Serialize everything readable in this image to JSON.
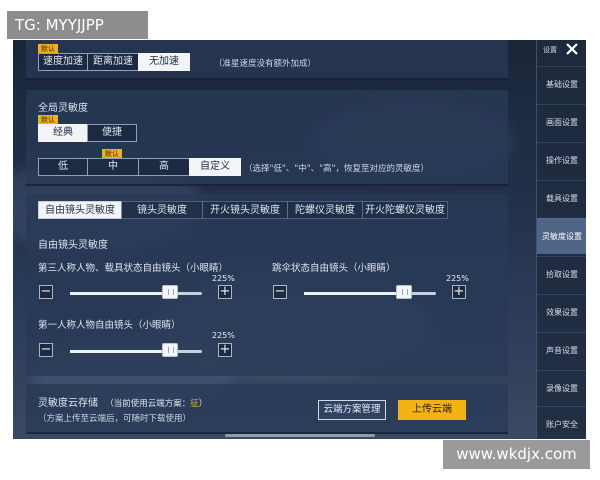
{
  "watermarks": {
    "top_left": "TG: MYYJJPP",
    "bottom_right": "www.wkdjx.com"
  },
  "speed_panel": {
    "default_badge": "默认",
    "options": [
      "速度加速",
      "距离加速",
      "无加速"
    ],
    "selected": "无加速",
    "note": "（准星速度没有额外加成）"
  },
  "global_sensitivity": {
    "title": "全局灵敏度",
    "mode_badge": "默认",
    "mode_options": [
      "经典",
      "便捷"
    ],
    "mode_selected": "经典",
    "level_badge": "默认",
    "level_options": [
      "低",
      "中",
      "高",
      "自定义"
    ],
    "level_selected": "自定义",
    "level_note": "（选择\"低\"、\"中\"、\"高\"，恢复至对应的灵敏度）"
  },
  "sensitivity_tabs": {
    "items": [
      "自由镜头灵敏度",
      "镜头灵敏度",
      "开火镜头灵敏度",
      "陀螺仪灵敏度",
      "开火陀螺仪灵敏度"
    ],
    "active": "自由镜头灵敏度"
  },
  "free_camera": {
    "section_title": "自由镜头灵敏度",
    "sliders": [
      {
        "label": "第三人称人物、载具状态自由镜头（小眼睛）",
        "value": "225%",
        "fraction": 0.72
      },
      {
        "label": "跳伞状态自由镜头（小眼睛）",
        "value": "225%",
        "fraction": 0.72
      },
      {
        "label": "第一人称人物自由镜头（小眼睛）",
        "value": "225%",
        "fraction": 0.72
      }
    ],
    "minus": "−",
    "plus": "+"
  },
  "cloud_storage": {
    "title": "灵敏度云存储",
    "current_prefix": "（当前使用云端方案：",
    "current_value": "征",
    "current_suffix": "）",
    "note": "（方案上传至云端后，可随时下载使用）",
    "manage_button": "云端方案管理",
    "upload_button": "上传云端"
  },
  "sidebar": {
    "settings_label": "设置",
    "close_icon": "close-icon",
    "items": [
      "基础设置",
      "画面设置",
      "操作设置",
      "载具设置",
      "灵敏度设置",
      "拾取设置",
      "效果设置",
      "声音设置",
      "录像设置",
      "账户安全"
    ],
    "active": "灵敏度设置"
  },
  "colors": {
    "accent_yellow": "#f2b313",
    "selected_bg": "#f2f4f7",
    "background": "#22304a"
  }
}
